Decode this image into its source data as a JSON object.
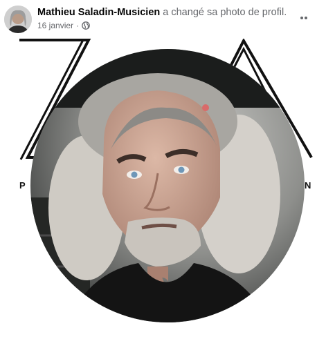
{
  "post": {
    "author_name": "Mathieu Saladin-Musicien",
    "action_text": " a changé sa photo de profil.",
    "date": "16 janvier",
    "separator": "·",
    "audience_icon": "globe-icon",
    "more_icon": "more-options-icon"
  },
  "photo_frame": {
    "letter_left": "P",
    "letter_right": "N"
  },
  "colors": {
    "name": "#050505",
    "secondary_text": "#65676b",
    "frame_lines": "#111111"
  }
}
